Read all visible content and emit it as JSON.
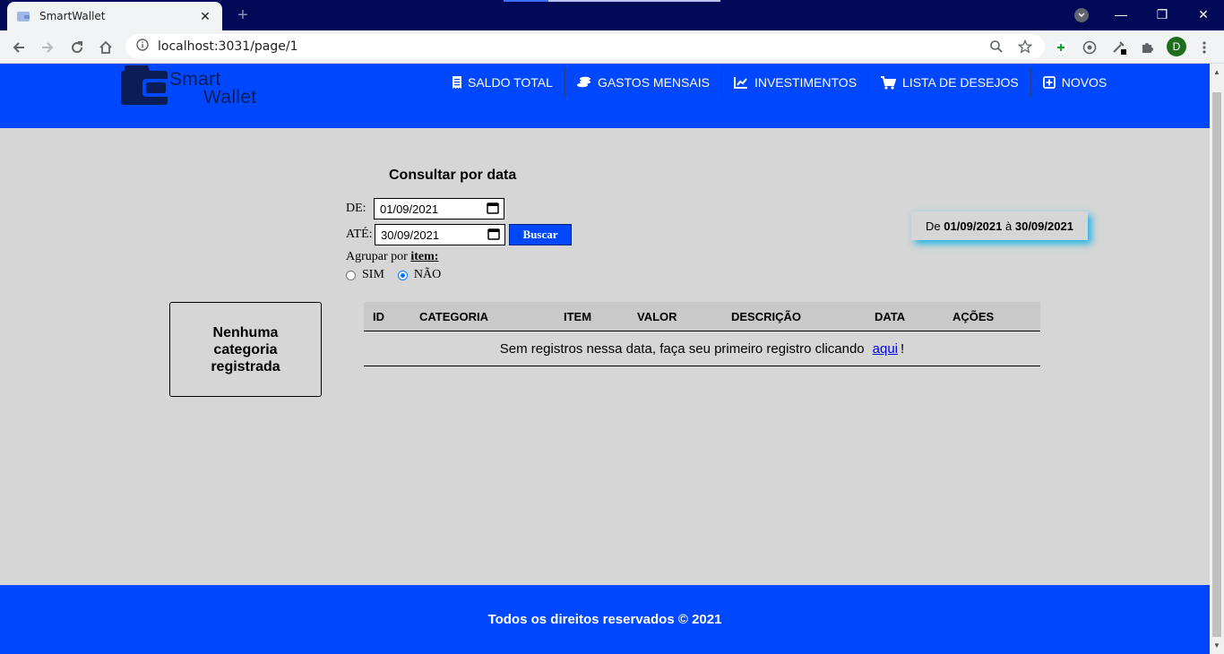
{
  "browser": {
    "tab_title": "SmartWallet",
    "tab_close": "✕",
    "new_tab": "+",
    "url": "localhost:3031/page/1",
    "profile_initial": "D",
    "win_minimize": "—",
    "win_restore": "❐",
    "win_close": "✕"
  },
  "header": {
    "logo_line1": "Smart",
    "logo_line2": "Wallet",
    "nav": [
      {
        "label": "SALDO TOTAL",
        "icon": "receipt-icon"
      },
      {
        "label": "GASTOS MENSAIS",
        "icon": "coins-icon"
      },
      {
        "label": "INVESTIMENTOS",
        "icon": "chart-line-icon"
      },
      {
        "label": "LISTA DE DESEJOS",
        "icon": "cart-icon"
      },
      {
        "label": "NOVOS",
        "icon": "plus-square-icon"
      }
    ]
  },
  "filter": {
    "title": "Consultar por data",
    "from_label": "DE:",
    "from_value": "01/09/2021",
    "to_label": "ATÉ:",
    "to_value": "30/09/2021",
    "search_button": "Buscar",
    "group_label": "Agrupar por",
    "group_item": "item:",
    "option_yes": "SIM",
    "option_no": "NÃO",
    "selected": "NÃO"
  },
  "period": {
    "prefix": "De",
    "start": "01/09/2021",
    "connector": "à",
    "end": "30/09/2021"
  },
  "categories_empty": "Nenhuma categoria registrada",
  "table": {
    "columns": [
      "ID",
      "CATEGORIA",
      "ITEM",
      "VALOR",
      "DESCRIÇÃO",
      "DATA",
      "AÇÕES"
    ],
    "empty_text": "Sem registros nessa data, faça seu primeiro registro clicando",
    "empty_link": "aqui",
    "empty_suffix": "!"
  },
  "footer": {
    "text": "Todos os direitos reservados © 2021"
  },
  "colors": {
    "brand_blue": "#0048ff",
    "page_bg": "#d6d6d6",
    "titlebar": "#020a57",
    "shadow_cyan": "#19b4e6"
  }
}
